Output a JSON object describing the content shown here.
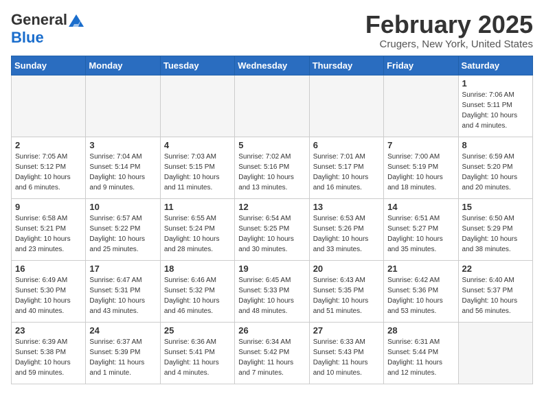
{
  "header": {
    "logo_line1": "General",
    "logo_line2": "Blue",
    "month": "February 2025",
    "location": "Crugers, New York, United States"
  },
  "weekdays": [
    "Sunday",
    "Monday",
    "Tuesday",
    "Wednesday",
    "Thursday",
    "Friday",
    "Saturday"
  ],
  "weeks": [
    [
      {
        "day": "",
        "sunrise": "",
        "sunset": "",
        "daylight": ""
      },
      {
        "day": "",
        "sunrise": "",
        "sunset": "",
        "daylight": ""
      },
      {
        "day": "",
        "sunrise": "",
        "sunset": "",
        "daylight": ""
      },
      {
        "day": "",
        "sunrise": "",
        "sunset": "",
        "daylight": ""
      },
      {
        "day": "",
        "sunrise": "",
        "sunset": "",
        "daylight": ""
      },
      {
        "day": "",
        "sunrise": "",
        "sunset": "",
        "daylight": ""
      },
      {
        "day": "1",
        "sunrise": "Sunrise: 7:06 AM",
        "sunset": "Sunset: 5:11 PM",
        "daylight": "Daylight: 10 hours and 4 minutes."
      }
    ],
    [
      {
        "day": "2",
        "sunrise": "Sunrise: 7:05 AM",
        "sunset": "Sunset: 5:12 PM",
        "daylight": "Daylight: 10 hours and 6 minutes."
      },
      {
        "day": "3",
        "sunrise": "Sunrise: 7:04 AM",
        "sunset": "Sunset: 5:14 PM",
        "daylight": "Daylight: 10 hours and 9 minutes."
      },
      {
        "day": "4",
        "sunrise": "Sunrise: 7:03 AM",
        "sunset": "Sunset: 5:15 PM",
        "daylight": "Daylight: 10 hours and 11 minutes."
      },
      {
        "day": "5",
        "sunrise": "Sunrise: 7:02 AM",
        "sunset": "Sunset: 5:16 PM",
        "daylight": "Daylight: 10 hours and 13 minutes."
      },
      {
        "day": "6",
        "sunrise": "Sunrise: 7:01 AM",
        "sunset": "Sunset: 5:17 PM",
        "daylight": "Daylight: 10 hours and 16 minutes."
      },
      {
        "day": "7",
        "sunrise": "Sunrise: 7:00 AM",
        "sunset": "Sunset: 5:19 PM",
        "daylight": "Daylight: 10 hours and 18 minutes."
      },
      {
        "day": "8",
        "sunrise": "Sunrise: 6:59 AM",
        "sunset": "Sunset: 5:20 PM",
        "daylight": "Daylight: 10 hours and 20 minutes."
      }
    ],
    [
      {
        "day": "9",
        "sunrise": "Sunrise: 6:58 AM",
        "sunset": "Sunset: 5:21 PM",
        "daylight": "Daylight: 10 hours and 23 minutes."
      },
      {
        "day": "10",
        "sunrise": "Sunrise: 6:57 AM",
        "sunset": "Sunset: 5:22 PM",
        "daylight": "Daylight: 10 hours and 25 minutes."
      },
      {
        "day": "11",
        "sunrise": "Sunrise: 6:55 AM",
        "sunset": "Sunset: 5:24 PM",
        "daylight": "Daylight: 10 hours and 28 minutes."
      },
      {
        "day": "12",
        "sunrise": "Sunrise: 6:54 AM",
        "sunset": "Sunset: 5:25 PM",
        "daylight": "Daylight: 10 hours and 30 minutes."
      },
      {
        "day": "13",
        "sunrise": "Sunrise: 6:53 AM",
        "sunset": "Sunset: 5:26 PM",
        "daylight": "Daylight: 10 hours and 33 minutes."
      },
      {
        "day": "14",
        "sunrise": "Sunrise: 6:51 AM",
        "sunset": "Sunset: 5:27 PM",
        "daylight": "Daylight: 10 hours and 35 minutes."
      },
      {
        "day": "15",
        "sunrise": "Sunrise: 6:50 AM",
        "sunset": "Sunset: 5:29 PM",
        "daylight": "Daylight: 10 hours and 38 minutes."
      }
    ],
    [
      {
        "day": "16",
        "sunrise": "Sunrise: 6:49 AM",
        "sunset": "Sunset: 5:30 PM",
        "daylight": "Daylight: 10 hours and 40 minutes."
      },
      {
        "day": "17",
        "sunrise": "Sunrise: 6:47 AM",
        "sunset": "Sunset: 5:31 PM",
        "daylight": "Daylight: 10 hours and 43 minutes."
      },
      {
        "day": "18",
        "sunrise": "Sunrise: 6:46 AM",
        "sunset": "Sunset: 5:32 PM",
        "daylight": "Daylight: 10 hours and 46 minutes."
      },
      {
        "day": "19",
        "sunrise": "Sunrise: 6:45 AM",
        "sunset": "Sunset: 5:33 PM",
        "daylight": "Daylight: 10 hours and 48 minutes."
      },
      {
        "day": "20",
        "sunrise": "Sunrise: 6:43 AM",
        "sunset": "Sunset: 5:35 PM",
        "daylight": "Daylight: 10 hours and 51 minutes."
      },
      {
        "day": "21",
        "sunrise": "Sunrise: 6:42 AM",
        "sunset": "Sunset: 5:36 PM",
        "daylight": "Daylight: 10 hours and 53 minutes."
      },
      {
        "day": "22",
        "sunrise": "Sunrise: 6:40 AM",
        "sunset": "Sunset: 5:37 PM",
        "daylight": "Daylight: 10 hours and 56 minutes."
      }
    ],
    [
      {
        "day": "23",
        "sunrise": "Sunrise: 6:39 AM",
        "sunset": "Sunset: 5:38 PM",
        "daylight": "Daylight: 10 hours and 59 minutes."
      },
      {
        "day": "24",
        "sunrise": "Sunrise: 6:37 AM",
        "sunset": "Sunset: 5:39 PM",
        "daylight": "Daylight: 11 hours and 1 minute."
      },
      {
        "day": "25",
        "sunrise": "Sunrise: 6:36 AM",
        "sunset": "Sunset: 5:41 PM",
        "daylight": "Daylight: 11 hours and 4 minutes."
      },
      {
        "day": "26",
        "sunrise": "Sunrise: 6:34 AM",
        "sunset": "Sunset: 5:42 PM",
        "daylight": "Daylight: 11 hours and 7 minutes."
      },
      {
        "day": "27",
        "sunrise": "Sunrise: 6:33 AM",
        "sunset": "Sunset: 5:43 PM",
        "daylight": "Daylight: 11 hours and 10 minutes."
      },
      {
        "day": "28",
        "sunrise": "Sunrise: 6:31 AM",
        "sunset": "Sunset: 5:44 PM",
        "daylight": "Daylight: 11 hours and 12 minutes."
      },
      {
        "day": "",
        "sunrise": "",
        "sunset": "",
        "daylight": ""
      }
    ]
  ]
}
